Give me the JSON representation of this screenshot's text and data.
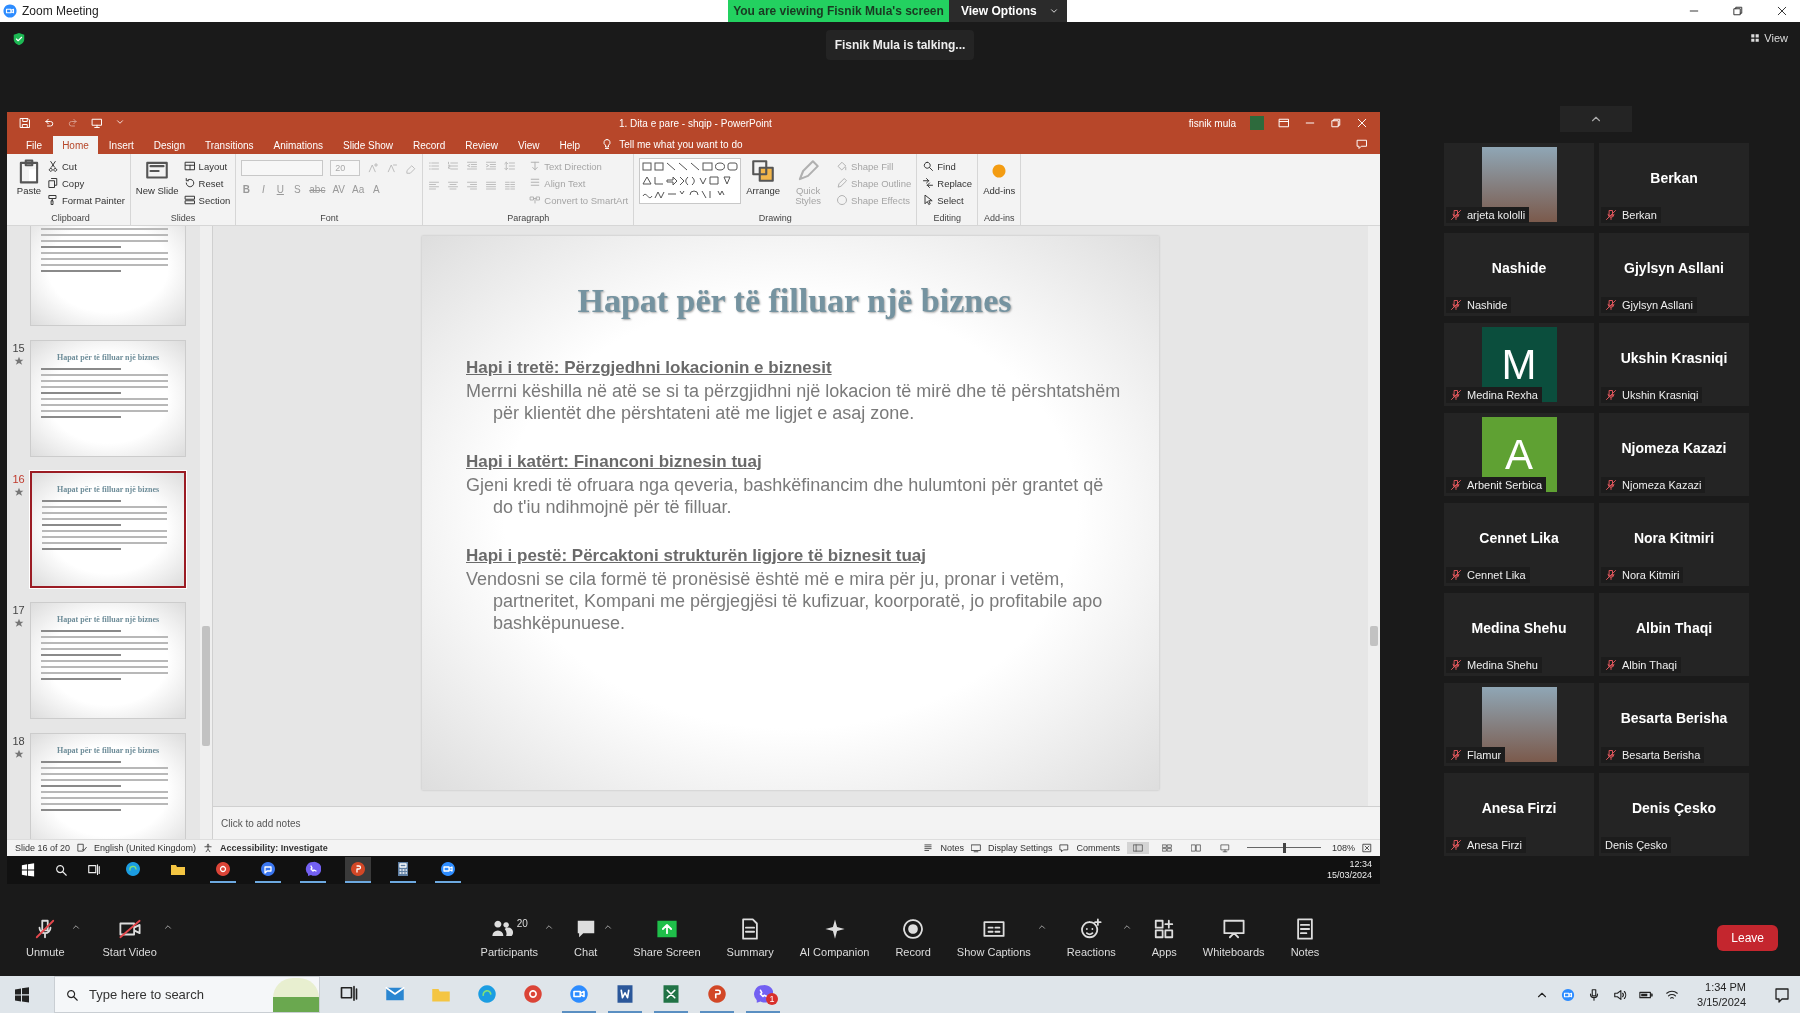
{
  "window": {
    "title": "Zoom Meeting"
  },
  "share_banner": {
    "message": "You are viewing Fisnik Mula's screen",
    "button": "View Options"
  },
  "talking_toast": "Fisnik Mula is talking...",
  "view_button": "View",
  "powerpoint": {
    "title": "1. Dita e pare - shqip  -  PowerPoint",
    "user": "fisnik mula",
    "tabs": [
      {
        "label": "File",
        "selected": false
      },
      {
        "label": "Home",
        "selected": true
      },
      {
        "label": "Insert",
        "selected": false
      },
      {
        "label": "Design",
        "selected": false
      },
      {
        "label": "Transitions",
        "selected": false
      },
      {
        "label": "Animations",
        "selected": false
      },
      {
        "label": "Slide Show",
        "selected": false
      },
      {
        "label": "Record",
        "selected": false
      },
      {
        "label": "Review",
        "selected": false
      },
      {
        "label": "View",
        "selected": false
      },
      {
        "label": "Help",
        "selected": false
      }
    ],
    "tell_me": "Tell me what you want to do",
    "ribbon_groups": [
      {
        "kind": "standard",
        "label": "Clipboard",
        "columns": [
          [
            {
              "kind": "paste",
              "label": "Paste",
              "disabled": false
            }
          ],
          [
            {
              "kind": "cut",
              "label": "Cut",
              "disabled": false
            },
            {
              "kind": "copy",
              "label": "Copy",
              "disabled": false
            },
            {
              "kind": "painter",
              "label": "Format Painter",
              "disabled": false
            }
          ]
        ]
      },
      {
        "kind": "standard",
        "label": "Slides",
        "columns": [
          [
            {
              "kind": "newslide",
              "label": "New Slide",
              "disabled": false
            }
          ],
          [
            {
              "kind": "layout",
              "label": "Layout",
              "disabled": false
            },
            {
              "kind": "reset",
              "label": "Reset",
              "disabled": false
            },
            {
              "kind": "section",
              "label": "Section",
              "disabled": false
            }
          ]
        ]
      },
      {
        "kind": "font",
        "label": "Font",
        "font_size": "20",
        "format_buttons": [
          "B",
          "I",
          "U",
          "S",
          "abc",
          "AV",
          "Aa",
          "A"
        ]
      },
      {
        "kind": "paragraph",
        "label": "Paragraph",
        "columns": [
          [
            {
              "kind": "textdir",
              "label": "Text Direction",
              "disabled": true
            },
            {
              "kind": "align",
              "label": "Align Text",
              "disabled": true
            },
            {
              "kind": "smartart",
              "label": "Convert to SmartArt",
              "disabled": true
            }
          ]
        ]
      },
      {
        "kind": "drawing",
        "label": "Drawing",
        "columns": [
          [
            {
              "kind": "arrange",
              "label": "Arrange",
              "disabled": false
            }
          ],
          [
            {
              "kind": "styles",
              "label": "Quick Styles",
              "disabled": true
            }
          ],
          [
            {
              "kind": "fill",
              "label": "Shape Fill",
              "disabled": true
            },
            {
              "kind": "outline",
              "label": "Shape Outline",
              "disabled": true
            },
            {
              "kind": "effects",
              "label": "Shape Effects",
              "disabled": true
            }
          ]
        ]
      },
      {
        "kind": "standard",
        "label": "Editing",
        "columns": [
          [
            {
              "kind": "find",
              "label": "Find",
              "disabled": false
            },
            {
              "kind": "replace",
              "label": "Replace",
              "disabled": false
            },
            {
              "kind": "select",
              "label": "Select",
              "disabled": false
            }
          ]
        ]
      },
      {
        "kind": "standard",
        "label": "Add-ins",
        "columns": [
          [
            {
              "kind": "addins",
              "label": "Add-ins",
              "disabled": false
            }
          ]
        ]
      }
    ],
    "thumbnails": [
      {
        "selected": false
      },
      {
        "number": "15",
        "title": "Hapat për të filluar një biznes",
        "animated": true,
        "selected": false
      },
      {
        "number": "16",
        "title": "Hapat për të filluar një biznes",
        "animated": true,
        "selected": true
      },
      {
        "number": "17",
        "title": "Hapat për të filluar një biznes",
        "animated": true,
        "selected": false
      },
      {
        "number": "18",
        "title": "Hapat për të filluar një biznes",
        "animated": true,
        "selected": false
      }
    ],
    "slide": {
      "title": "Hapat për të filluar një biznes",
      "sections": [
        {
          "heading": "Hapi i tretë: Përzgjedhni lokacionin e biznesit",
          "body": "Merrni këshilla në atë se si ta përzgjidhni një lokacion të mirë dhe të përshtatshëm për klientët dhe përshtateni atë me ligjet e asaj zone."
        },
        {
          "heading": "Hapi i katërt: Financoni biznesin tuaj",
          "body": "Gjeni kredi të ofruara nga qeveria, bashkëfinancim dhe hulumtoni për grantet që do t'iu ndihmojnë për të filluar."
        },
        {
          "heading": "Hapi i pestë:  Përcaktoni strukturën ligjore të biznesit tuaj",
          "body": "Vendosni se cila formë të pronësisë është më e mira për ju, pronar i vetëm, partneritet, Kompani me përgjegjësi të kufizuar, koorporatë, jo profitabile apo bashkëpunuese."
        }
      ]
    },
    "notes_placeholder": "Click to add notes",
    "status_bar": {
      "slide_info": "Slide 16 of 20",
      "language": "English (United Kingdom)",
      "accessibility": "Accessibility: Investigate",
      "notes": "Notes",
      "display_settings": "Display Settings",
      "comments": "Comments",
      "view_modes": [
        {
          "kind": "normal",
          "selected": true
        },
        {
          "kind": "sorter",
          "selected": false
        },
        {
          "kind": "reading",
          "selected": false
        },
        {
          "kind": "slideshow",
          "selected": false
        }
      ],
      "zoom": {
        "level": 0.5,
        "reading": "108%"
      }
    }
  },
  "shared_taskbar": {
    "apps": [
      {
        "kind": "edge",
        "running": false,
        "selected": false
      },
      {
        "kind": "folder",
        "running": false,
        "selected": false
      },
      {
        "kind": "chrome",
        "running": true,
        "selected": false
      },
      {
        "kind": "signal",
        "running": true,
        "selected": false
      },
      {
        "kind": "viber",
        "running": true,
        "selected": false
      },
      {
        "kind": "powerpoint",
        "running": true,
        "selected": true
      },
      {
        "kind": "calculator",
        "running": true,
        "selected": false
      },
      {
        "kind": "zoom",
        "running": true,
        "selected": false
      }
    ],
    "time": "12:34",
    "date": "15/03/2024"
  },
  "participants": [
    {
      "name": "arjeta kololli",
      "kind": "photo",
      "muted": true
    },
    {
      "name": "Berkan",
      "kind": "text",
      "tile_text": "Berkan",
      "muted": true
    },
    {
      "name": "Nashide",
      "kind": "text",
      "tile_text": "Nashide",
      "muted": true
    },
    {
      "name": "Gjylsyn Asllani",
      "kind": "text",
      "tile_text": "Gjylsyn Asllani",
      "muted": true
    },
    {
      "name": "Medina Rexha",
      "kind": "initial",
      "initial": "M",
      "color": "#0b4e3d",
      "muted": true
    },
    {
      "name": "Ukshin Krasniqi",
      "kind": "text",
      "tile_text": "Ukshin Krasniqi",
      "muted": true
    },
    {
      "name": "Arbenit Serbica",
      "kind": "initial",
      "initial": "A",
      "color": "#5fa133",
      "muted": true
    },
    {
      "name": "Njomeza Kazazi",
      "kind": "text",
      "tile_text": "Njomeza Kazazi",
      "muted": true
    },
    {
      "name": "Cennet Lika",
      "kind": "text",
      "tile_text": "Cennet Lika",
      "muted": true
    },
    {
      "name": "Nora Kitmiri",
      "kind": "text",
      "tile_text": "Nora Kitmiri",
      "muted": true
    },
    {
      "name": "Medina Shehu",
      "kind": "text",
      "tile_text": "Medina Shehu",
      "muted": true
    },
    {
      "name": "Albin Thaqi",
      "kind": "text",
      "tile_text": "Albin Thaqi",
      "muted": true
    },
    {
      "name": "Flamur",
      "kind": "photo",
      "muted": true
    },
    {
      "name": "Besarta Berisha",
      "kind": "text",
      "tile_text": "Besarta Berisha",
      "muted": true
    },
    {
      "name": "Anesa Firzi",
      "kind": "text",
      "tile_text": "Anesa Firzi",
      "muted": true
    },
    {
      "name": "Denis Çesko",
      "kind": "text",
      "tile_text": "Denis Çesko",
      "muted": false
    }
  ],
  "toolbar": {
    "left": [
      {
        "kind": "micoff",
        "label": "Unmute",
        "caret": true
      },
      {
        "kind": "videooff",
        "label": "Start Video",
        "caret": true
      }
    ],
    "center": [
      {
        "kind": "participants",
        "label": "Participants",
        "count": "20",
        "caret": true
      },
      {
        "kind": "chat",
        "label": "Chat",
        "caret": true
      },
      {
        "kind": "share",
        "label": "Share Screen",
        "caret": false
      },
      {
        "kind": "summary",
        "label": "Summary",
        "caret": false
      },
      {
        "kind": "ai",
        "label": "AI Companion",
        "caret": false
      },
      {
        "kind": "record",
        "label": "Record",
        "caret": false
      },
      {
        "kind": "captions",
        "label": "Show Captions",
        "caret": true
      },
      {
        "kind": "reactions",
        "label": "Reactions",
        "caret": true
      },
      {
        "kind": "apps",
        "label": "Apps",
        "caret": false
      },
      {
        "kind": "whiteboard",
        "label": "Whiteboards",
        "caret": false
      },
      {
        "kind": "notes",
        "label": "Notes",
        "caret": false
      }
    ],
    "leave": "Leave"
  },
  "taskbar": {
    "search_placeholder": "Type here to search",
    "apps": [
      {
        "kind": "taskview",
        "running": false
      },
      {
        "kind": "mail",
        "running": false
      },
      {
        "kind": "folder",
        "running": false
      },
      {
        "kind": "edge",
        "running": false
      },
      {
        "kind": "chrome",
        "running": false
      },
      {
        "kind": "zoom",
        "running": true
      },
      {
        "kind": "word",
        "running": true
      },
      {
        "kind": "excel",
        "running": true
      },
      {
        "kind": "powerpoint",
        "running": true
      },
      {
        "kind": "viber",
        "running": true,
        "badge": "1"
      }
    ],
    "time": "1:34 PM",
    "date": "3/15/2024"
  }
}
